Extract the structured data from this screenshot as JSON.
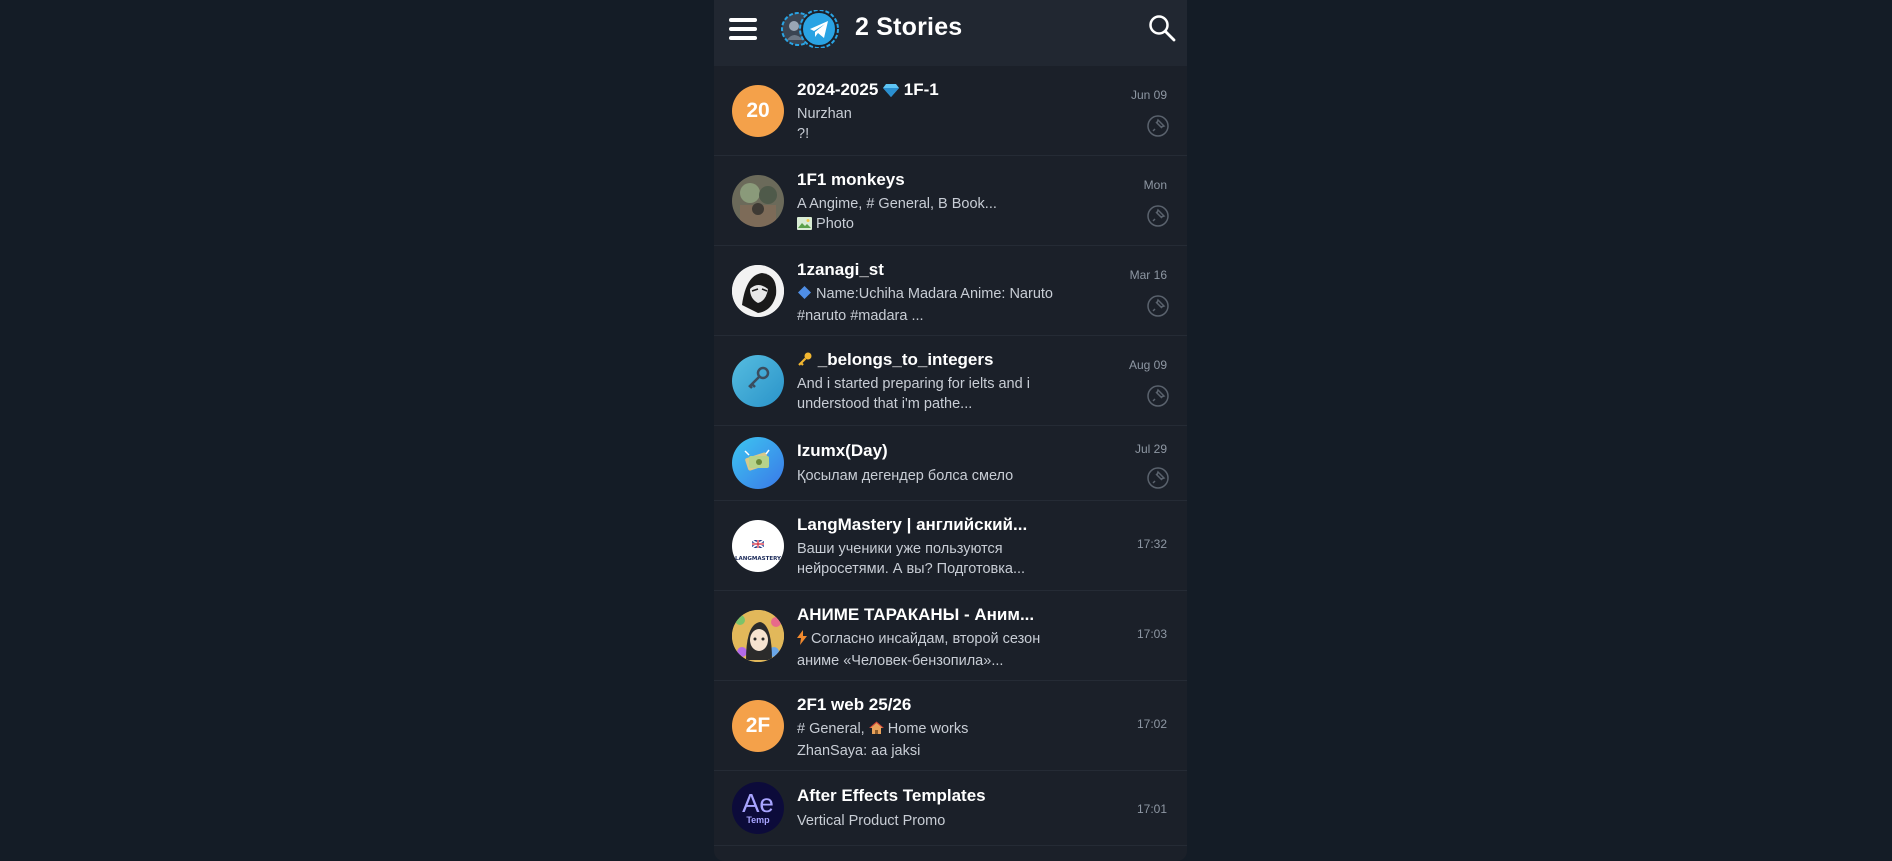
{
  "header": {
    "title": "2 Stories",
    "menu_icon": "hamburger-menu-icon",
    "search_icon": "search-icon"
  },
  "colors": {
    "accent_orange": "#f4a14a",
    "accent_blue": "#2aa3e3",
    "background": "#1b2029"
  },
  "chats": [
    {
      "name_left": "2024-2025",
      "name_right": "1F-1",
      "avatar_text": "20",
      "line1": "Nurzhan",
      "line2": "?!",
      "time": "Jun 09",
      "pinned": true
    },
    {
      "name": "1F1 monkeys",
      "line1": "A Angime, # General, B Book...",
      "line2": "Photo",
      "time": "Mon",
      "pinned": true
    },
    {
      "name": "1zanagi_st",
      "line1": "Name:Uchiha Madara Anime: Naruto",
      "line2": "#naruto #madara ...",
      "time": "Mar 16",
      "pinned": true
    },
    {
      "name": "_belongs_to_integers",
      "line1": "And i started preparing for ielts and i",
      "line2": "understood that i'm pathe...",
      "time": "Aug 09",
      "pinned": true
    },
    {
      "name": "Izumx(Day)",
      "line1": "Қосылам дегендер болса смело",
      "time": "Jul 29",
      "pinned": true
    },
    {
      "name": "LangMastery | английский...",
      "avatar_text": "LANGMASTERY",
      "line1": "Ваши ученики уже пользуются",
      "line2": "нейросетями. А вы? Подготовка...",
      "time": "17:32",
      "pinned": false
    },
    {
      "name": "АНИМЕ ТАРАКАНЫ - Аним...",
      "line1": "Согласно инсайдам, второй сезон",
      "line2": "аниме «Человек-бензопила»...",
      "time": "17:03",
      "pinned": false
    },
    {
      "name": "2F1 web 25/26",
      "avatar_text": "2F",
      "line1a": "# General,",
      "line1b": "Home works",
      "line2": "ZhanSaya: aa jaksi",
      "time": "17:02",
      "pinned": false
    },
    {
      "name": "After Effects Templates",
      "avatar_text": "Ae",
      "avatar_sub": "Temp",
      "line1": "Vertical Product Promo",
      "time": "17:01",
      "pinned": false
    }
  ]
}
